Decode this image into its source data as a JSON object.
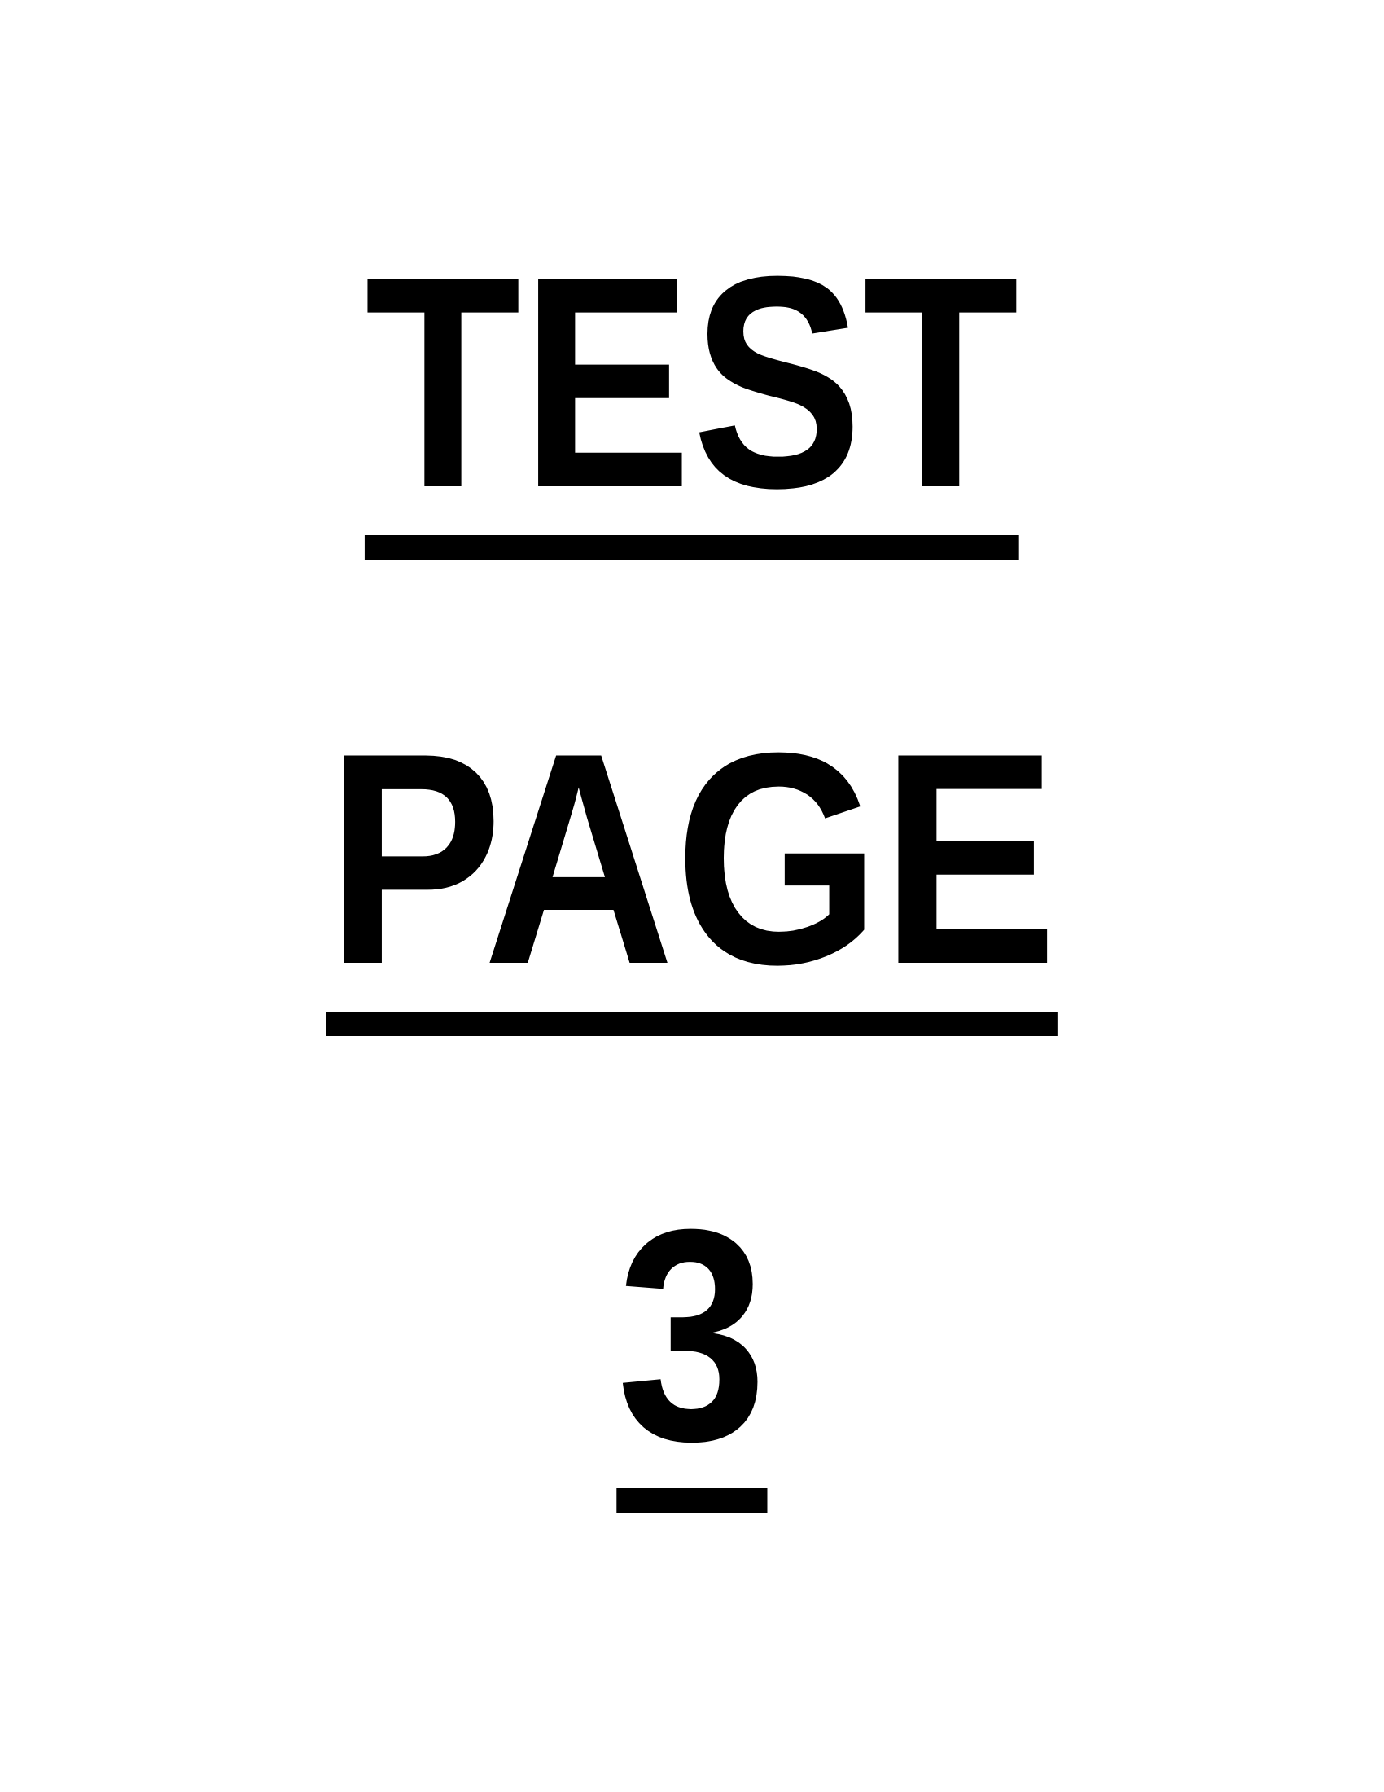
{
  "document": {
    "lines": [
      "TEST",
      "PAGE",
      "3"
    ]
  }
}
